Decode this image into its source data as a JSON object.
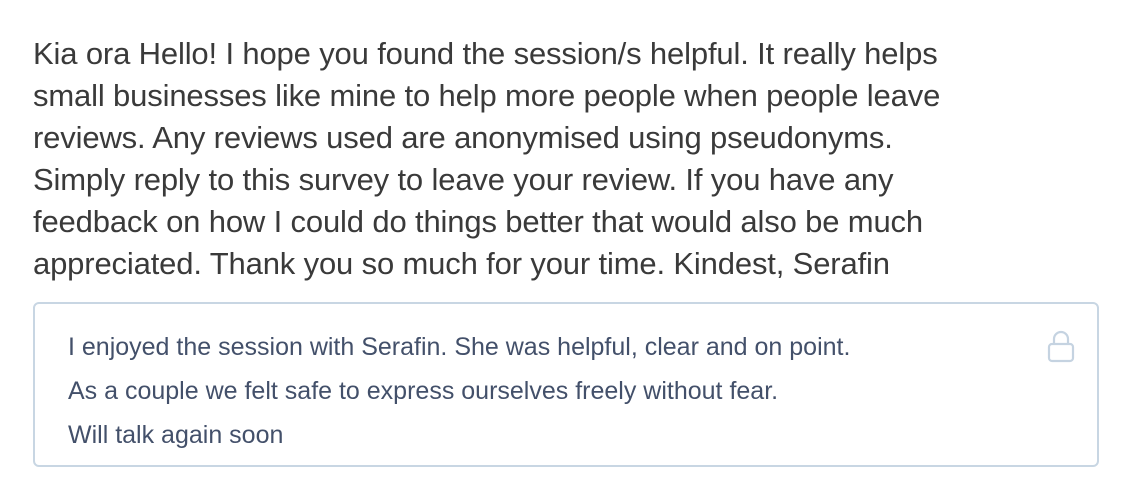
{
  "message": {
    "lines": [
      "Kia ora Hello! I hope you found the session/s helpful. It really helps",
      "small businesses like mine to help more people when people leave",
      "reviews. Any reviews used are anonymised using pseudonyms.",
      "Simply reply to this survey to leave your review. If you have any",
      "feedback on how I could do things better that would also be much",
      "appreciated. Thank you so much for your time. Kindest, Serafin"
    ]
  },
  "response": {
    "lines": [
      "I enjoyed the session with Serafin. She was helpful, clear and on point.",
      "As a couple we felt safe to express ourselves freely without fear.",
      "Will talk again soon"
    ],
    "locked": true,
    "icon": "lock-icon"
  },
  "colors": {
    "message_text": "#3a3a3a",
    "response_text": "#43506a",
    "box_border": "#c8d6e3",
    "lock_icon": "#c5d3e1"
  }
}
